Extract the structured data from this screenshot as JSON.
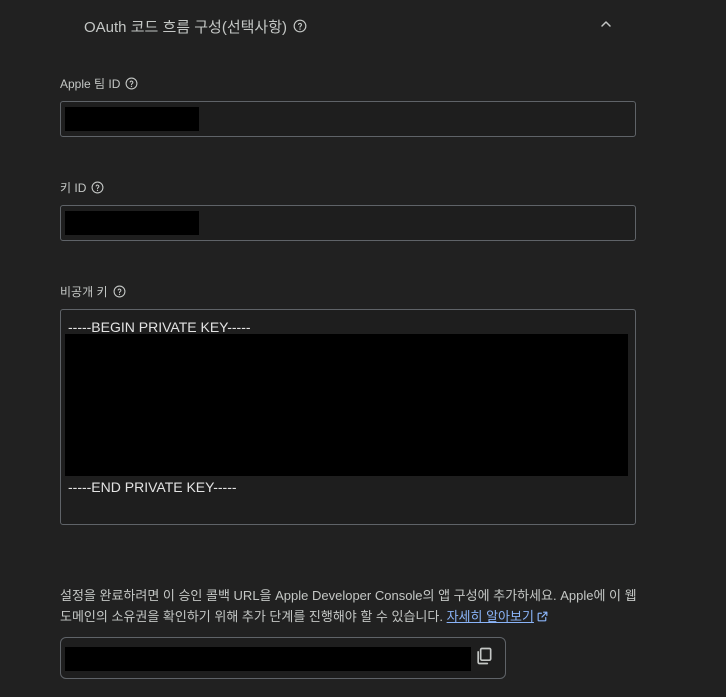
{
  "section": {
    "title": "OAuth 코드 흐름 구성(선택사항)",
    "help_icon": "help-circle-icon",
    "toggle_icon": "chevron-up-icon"
  },
  "fields": {
    "team_id": {
      "label": "Apple 팀 ID",
      "value_redacted": true
    },
    "key_id": {
      "label": "키 ID",
      "value_redacted": true
    },
    "private_key": {
      "label": "비공개 키",
      "begin_line": "-----BEGIN PRIVATE KEY-----",
      "end_line": "-----END PRIVATE KEY-----",
      "value_redacted": true
    }
  },
  "description": {
    "text": "설정을 완료하려면 이 승인 콜백 URL을 Apple Developer Console의 앱 구성에 추가하세요. Apple에 이 웹 도메인의 소유권을 확인하기 위해 추가 단계를 진행해야 할 수 있습니다.",
    "link_text": "자세히 알아보기",
    "link_icon": "open-in-new-icon"
  },
  "callback_url": {
    "value_redacted": true,
    "copy_icon": "copy-icon"
  },
  "colors": {
    "background": "#212121",
    "border": "#5f6368",
    "text": "#e3e3e3",
    "muted_text": "#c4c7c5",
    "link": "#8ab4f8",
    "redaction": "#000000"
  }
}
